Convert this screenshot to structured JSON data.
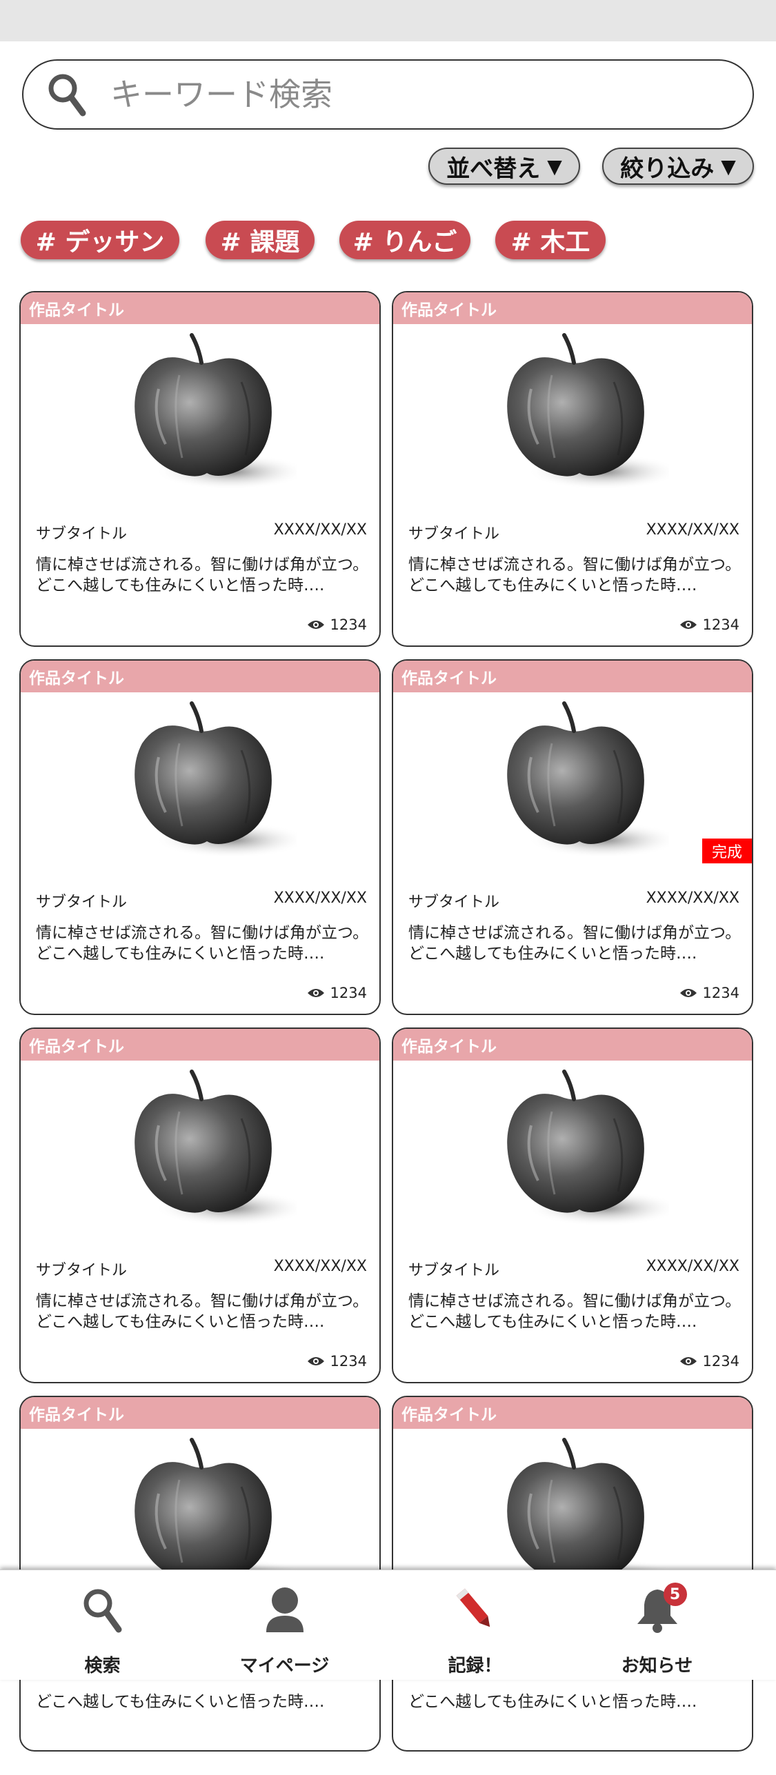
{
  "search": {
    "placeholder": "キーワード検索"
  },
  "toolbar": {
    "sort_label": "並べ替え",
    "filter_label": "絞り込み",
    "caret": "▼"
  },
  "tags": [
    "# デッサン",
    "# 課題",
    "# りんご",
    "# 木工"
  ],
  "cards": [
    {
      "title": "作品タイトル",
      "subtitle": "サブタイトル",
      "date": "XXXX/XX/XX",
      "desc1": "情に棹させば流される。智に働けば角が立つ。",
      "desc2": "どこへ越しても住みにくいと悟った時….",
      "views": "1234",
      "badge": ""
    },
    {
      "title": "作品タイトル",
      "subtitle": "サブタイトル",
      "date": "XXXX/XX/XX",
      "desc1": "情に棹させば流される。智に働けば角が立つ。",
      "desc2": "どこへ越しても住みにくいと悟った時….",
      "views": "1234",
      "badge": ""
    },
    {
      "title": "作品タイトル",
      "subtitle": "サブタイトル",
      "date": "XXXX/XX/XX",
      "desc1": "情に棹させば流される。智に働けば角が立つ。",
      "desc2": "どこへ越しても住みにくいと悟った時….",
      "views": "1234",
      "badge": ""
    },
    {
      "title": "作品タイトル",
      "subtitle": "サブタイトル",
      "date": "XXXX/XX/XX",
      "desc1": "情に棹させば流される。智に働けば角が立つ。",
      "desc2": "どこへ越しても住みにくいと悟った時….",
      "views": "1234",
      "badge": "完成"
    },
    {
      "title": "作品タイトル",
      "subtitle": "サブタイトル",
      "date": "XXXX/XX/XX",
      "desc1": "情に棹させば流される。智に働けば角が立つ。",
      "desc2": "どこへ越しても住みにくいと悟った時….",
      "views": "1234",
      "badge": ""
    },
    {
      "title": "作品タイトル",
      "subtitle": "サブタイトル",
      "date": "XXXX/XX/XX",
      "desc1": "情に棹させば流される。智に働けば角が立つ。",
      "desc2": "どこへ越しても住みにくいと悟った時….",
      "views": "1234",
      "badge": ""
    },
    {
      "title": "作品タイトル",
      "subtitle": "",
      "date": "",
      "desc1": "",
      "desc2": "どこへ越しても住みにくいと悟った時….",
      "views": "",
      "badge": ""
    },
    {
      "title": "作品タイトル",
      "subtitle": "",
      "date": "",
      "desc1": "",
      "desc2": "どこへ越しても住みにくいと悟った時….",
      "views": "",
      "badge": ""
    }
  ],
  "nav": {
    "search_label": "検索",
    "mypage_label": "マイページ",
    "record_label": "記録！",
    "notice_label": "お知らせ",
    "notice_count": "5"
  },
  "colors": {
    "tag": "#c94b52",
    "card_header": "#e8a6aa",
    "badge": "#ff0000",
    "notice": "#c8323a"
  },
  "icons": [
    "search-icon",
    "person-icon",
    "pencil-icon",
    "bell-icon",
    "eye-icon",
    "apple-drawing"
  ]
}
